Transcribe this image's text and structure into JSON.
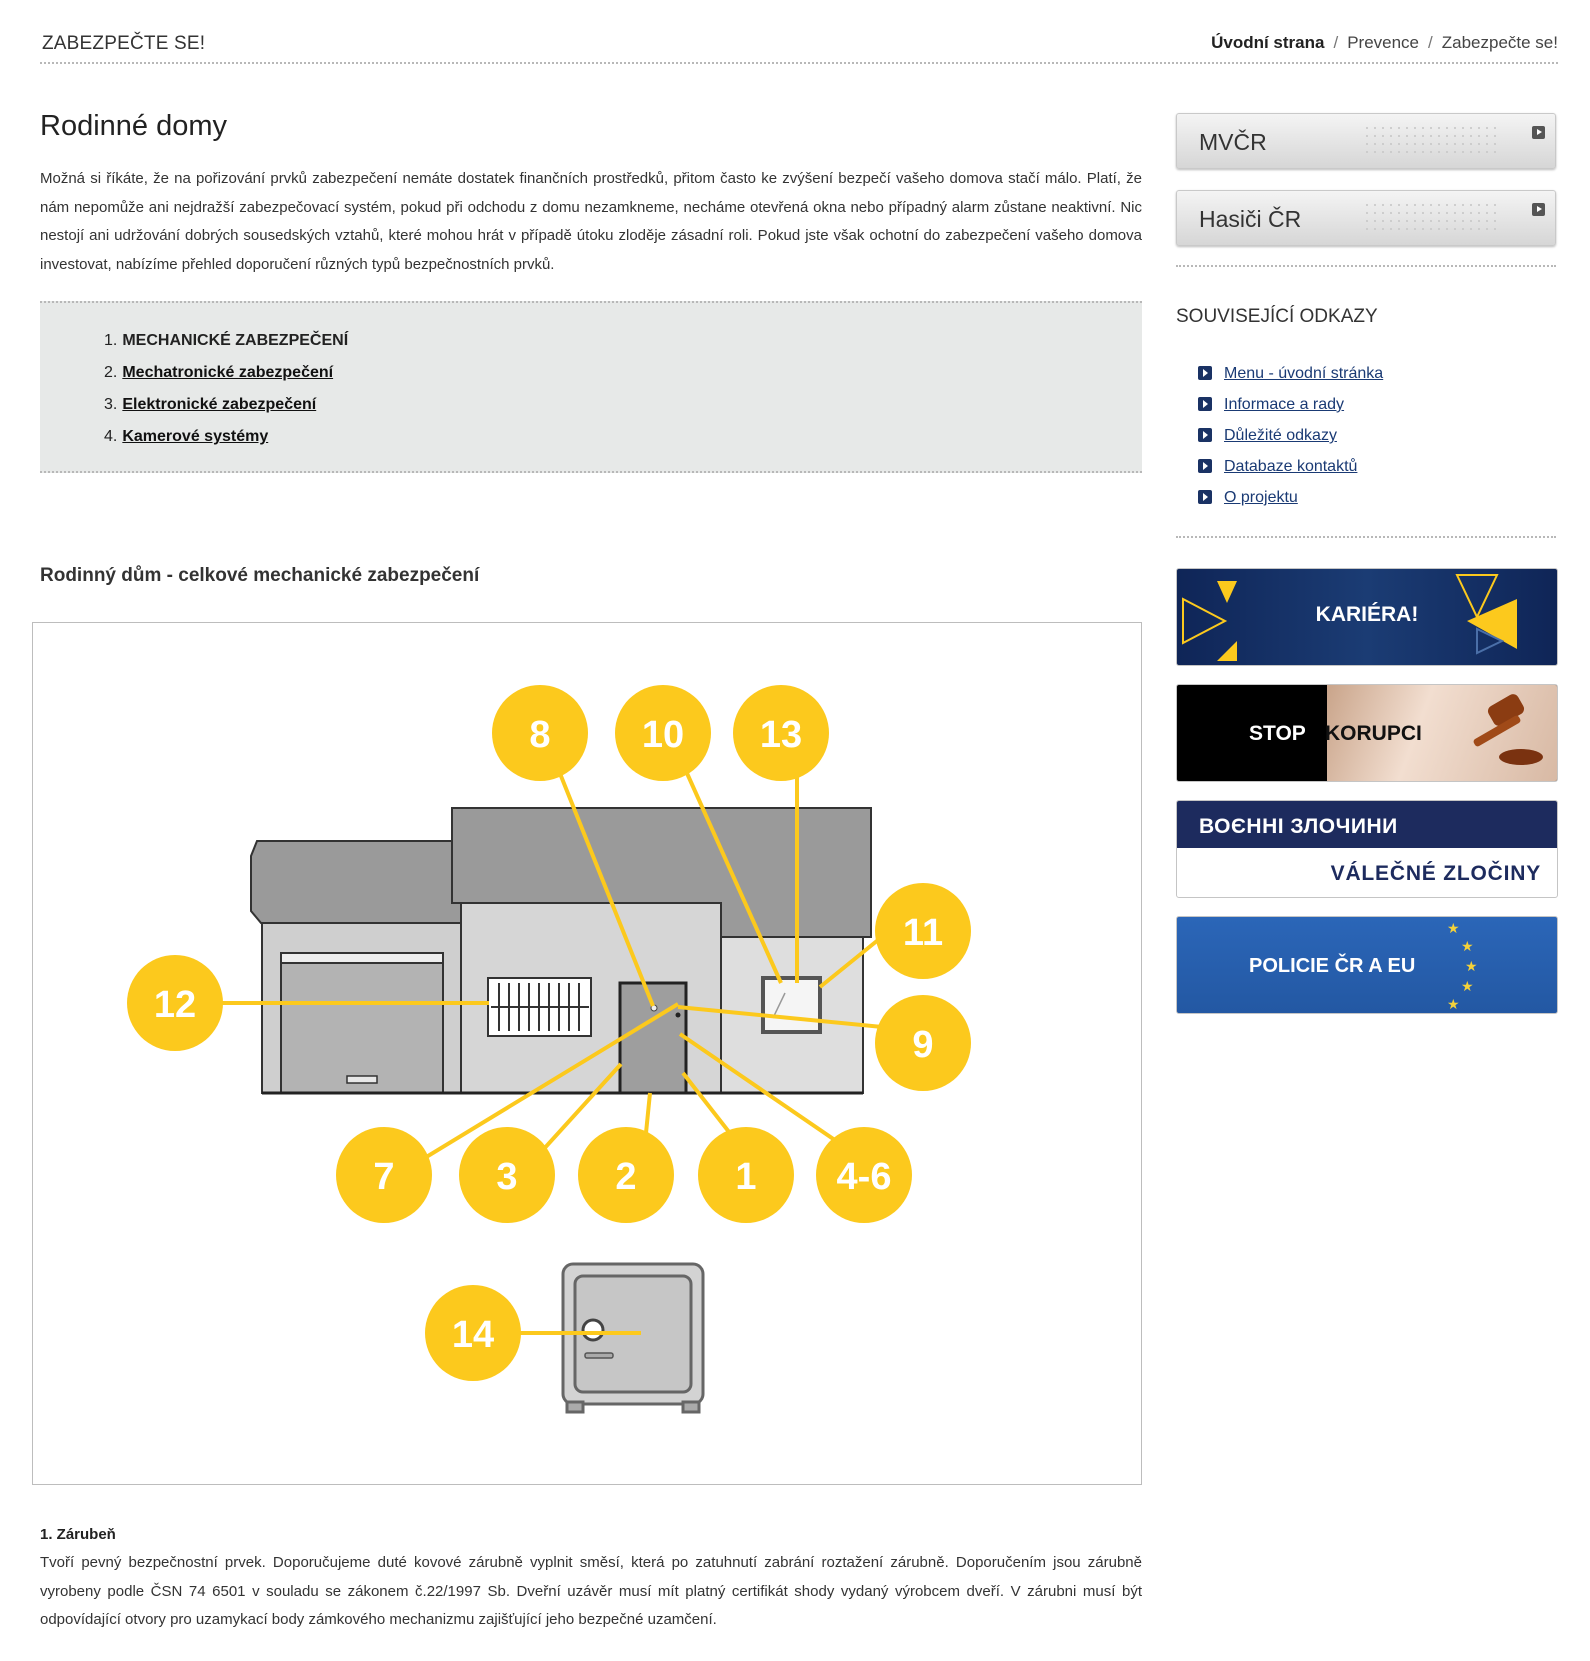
{
  "header": {
    "title": "ZABEZPEČTE SE!",
    "breadcrumb": [
      "Úvodní strana",
      "Prevence",
      "Zabezpečte se!"
    ]
  },
  "main": {
    "title": "Rodinné domy",
    "intro": "Možná si říkáte, že na pořizování prvků zabezpečení nemáte dostatek finančních prostředků, přitom často ke zvýšení bezpečí vašeho domova stačí málo. Platí, že nám nepomůže ani nejdražší zabezpečovací systém, pokud při odchodu z domu nezamkneme, necháme otevřená okna nebo případný alarm zůstane neaktivní. Nic nestojí ani udržování dobrých sousedských vztahů, které mohou hrát v případě útoku zloděje zásadní roli. Pokud jste však ochotní do zabezpečení vašeho domova investovat, nabízíme přehled doporučení různých typů bezpečnostních prvků.",
    "toc": [
      {
        "num": "1.",
        "label": "MECHANICKÉ ZABEZPEČENÍ",
        "link": false
      },
      {
        "num": "2.",
        "label": "Mechatronické zabezpečení",
        "link": true
      },
      {
        "num": "3.",
        "label": "Elektronické zabezpečení",
        "link": true
      },
      {
        "num": "4.",
        "label": "Kamerové systémy",
        "link": true
      }
    ],
    "section_heading": "Rodinný dům - celkové mechanické zabezpečení",
    "figure_labels": [
      "8",
      "10",
      "13",
      "11",
      "12",
      "9",
      "7",
      "3",
      "2",
      "1",
      "4-6",
      "14"
    ],
    "paragraph_title": "1. Zárubeň",
    "paragraph_text": "Tvoří pevný bezpečnostní prvek. Doporučujeme duté kovové zárubně vyplnit směsí, která po zatuhnutí zabrání roztažení zárubně. Doporučením jsou zárubně vyrobeny podle ČSN 74 6501 v souladu se zákonem č.22/1997 Sb. Dveřní uzávěr musí mít platný certifikát shody vydaný výrobcem dveří. V zárubni musí být odpovídající otvory pro uzamykací body zámkového mechanizmu zajišťující jeho bezpečné uzamčení."
  },
  "sidebar": {
    "buttons": [
      "MVČR",
      "Hasiči ČR"
    ],
    "related_heading": "SOUVISEJÍCÍ ODKAZY",
    "related_links": [
      "Menu - úvodní stránka",
      "Informace a rady",
      "Důležité odkazy",
      "Databaze kontaktů",
      "O projektu"
    ],
    "banners": {
      "kariera": "KARIÉRA!",
      "stop_1": "STOP",
      "stop_2": "KORUPCI",
      "valecne_top": "ВОЄННІ ЗЛОЧИНИ",
      "valecne_bottom": "VÁLEČNÉ ZLOČINY",
      "policie": "POLICIE ČR A EU"
    }
  },
  "colors": {
    "accent_yellow": "#fcc91d",
    "link_blue": "#1a3a74",
    "navy": "#1d2b5e"
  }
}
